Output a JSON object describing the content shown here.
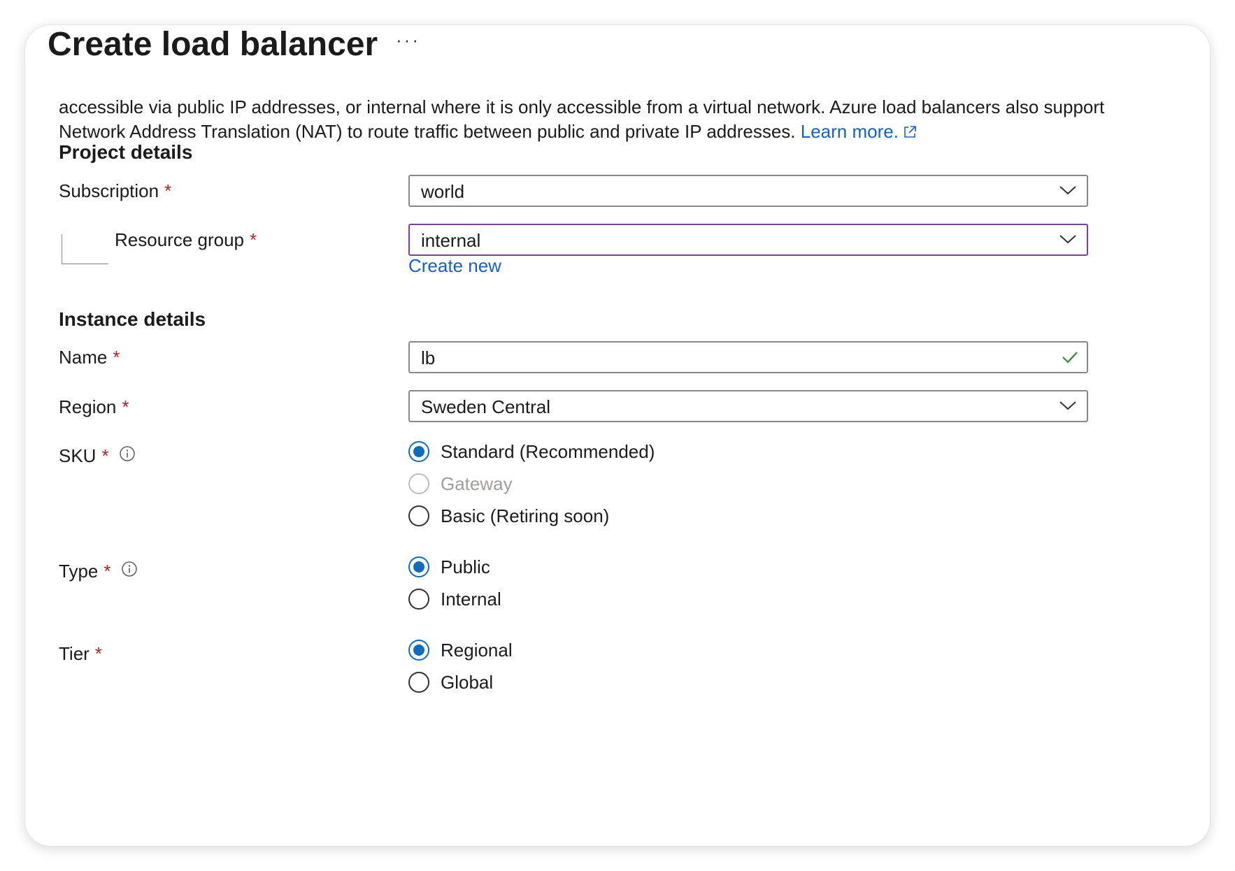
{
  "page": {
    "title": "Create load balancer",
    "more_label": "···"
  },
  "description": {
    "line1": "accessible via public IP addresses, or internal where it is only accessible from a virtual network. Azure load balancers also support",
    "line2": "Network Address Translation (NAT) to route traffic between public and private IP addresses.",
    "learn_more": "Learn more."
  },
  "project_details": {
    "heading": "Project details",
    "subscription": {
      "label": "Subscription",
      "required": "*",
      "value": "world"
    },
    "resource_group": {
      "label": "Resource group",
      "required": "*",
      "value": "internal",
      "create_new": "Create new"
    }
  },
  "instance_details": {
    "heading": "Instance details",
    "name": {
      "label": "Name",
      "required": "*",
      "value": "lb"
    },
    "region": {
      "label": "Region",
      "required": "*",
      "value": "Sweden Central"
    },
    "sku": {
      "label": "SKU",
      "required": "*",
      "options": [
        "Standard (Recommended)",
        "Gateway",
        "Basic (Retiring soon)"
      ],
      "selected": "Standard (Recommended)",
      "disabled": [
        "Gateway"
      ]
    },
    "type": {
      "label": "Type",
      "required": "*",
      "options": [
        "Public",
        "Internal"
      ],
      "selected": "Public"
    },
    "tier": {
      "label": "Tier",
      "required": "*",
      "options": [
        "Regional",
        "Global"
      ],
      "selected": "Regional"
    }
  },
  "colors": {
    "link": "#1560c4",
    "radio_selected": "#0f6cbd",
    "required": "#a4262c",
    "focus_border": "#7b3fa4",
    "valid_check": "#2f8a2f"
  }
}
